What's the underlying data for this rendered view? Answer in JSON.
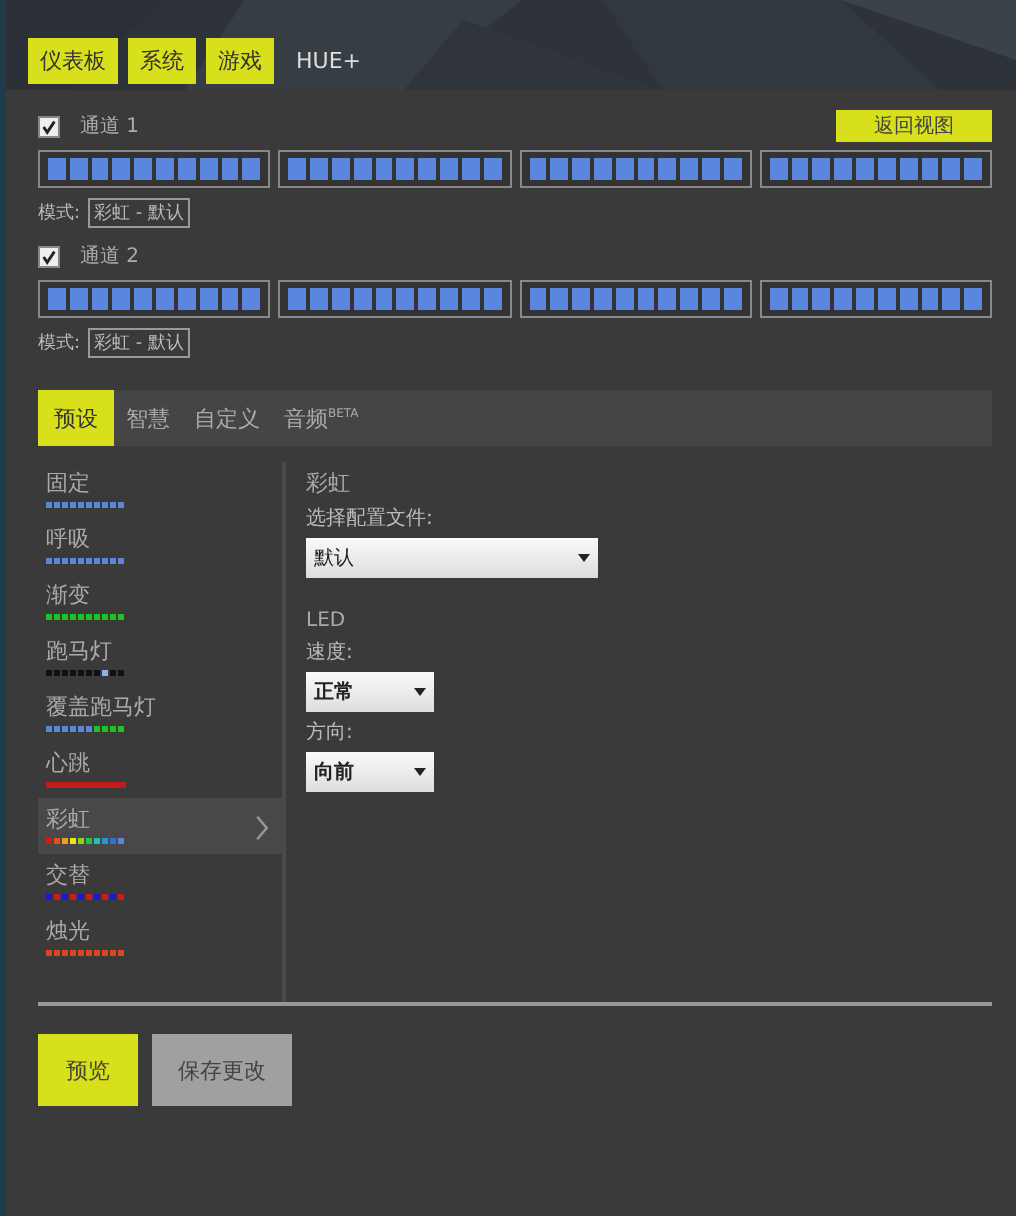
{
  "top_tabs": [
    {
      "label": "仪表板",
      "selected": false
    },
    {
      "label": "系统",
      "selected": false
    },
    {
      "label": "游戏",
      "selected": false
    },
    {
      "label": "HUE+",
      "selected": true
    }
  ],
  "back_button": "返回视图",
  "channels": [
    {
      "label": "通道 1",
      "checked": true,
      "mode_label": "模式:",
      "mode": "彩虹 - 默认"
    },
    {
      "label": "通道 2",
      "checked": true,
      "mode_label": "模式:",
      "mode": "彩虹 - 默认"
    }
  ],
  "sub_tabs": [
    {
      "label": "预设",
      "selected": true
    },
    {
      "label": "智慧",
      "selected": false
    },
    {
      "label": "自定义",
      "selected": false
    },
    {
      "label": "音频",
      "badge": "BETA",
      "selected": false
    }
  ],
  "presets": [
    {
      "name": "固定",
      "kind": "solid",
      "color": "#5b86d8",
      "selected": false
    },
    {
      "name": "呼吸",
      "kind": "solid",
      "color": "#5b86d8",
      "selected": false
    },
    {
      "name": "渐变",
      "kind": "solid",
      "color": "#1fc41f",
      "selected": false
    },
    {
      "name": "跑马灯",
      "kind": "marquee",
      "selected": false
    },
    {
      "name": "覆盖跑马灯",
      "kind": "cover",
      "selected": false
    },
    {
      "name": "心跳",
      "kind": "line",
      "color": "#c41a1a",
      "selected": false
    },
    {
      "name": "彩虹",
      "kind": "rainbow",
      "selected": true
    },
    {
      "name": "交替",
      "kind": "alternate",
      "selected": false
    },
    {
      "name": "烛光",
      "kind": "solid",
      "color": "#d9461f",
      "selected": false
    }
  ],
  "detail": {
    "title": "彩虹",
    "profile_label": "选择配置文件:",
    "profile": "默认",
    "section": "LED",
    "speed_label": "速度:",
    "speed": "正常",
    "direction_label": "方向:",
    "direction": "向前"
  },
  "buttons": [
    {
      "label": "预览",
      "kind": "primary"
    },
    {
      "label": "保存更改",
      "kind": "secondary"
    }
  ]
}
